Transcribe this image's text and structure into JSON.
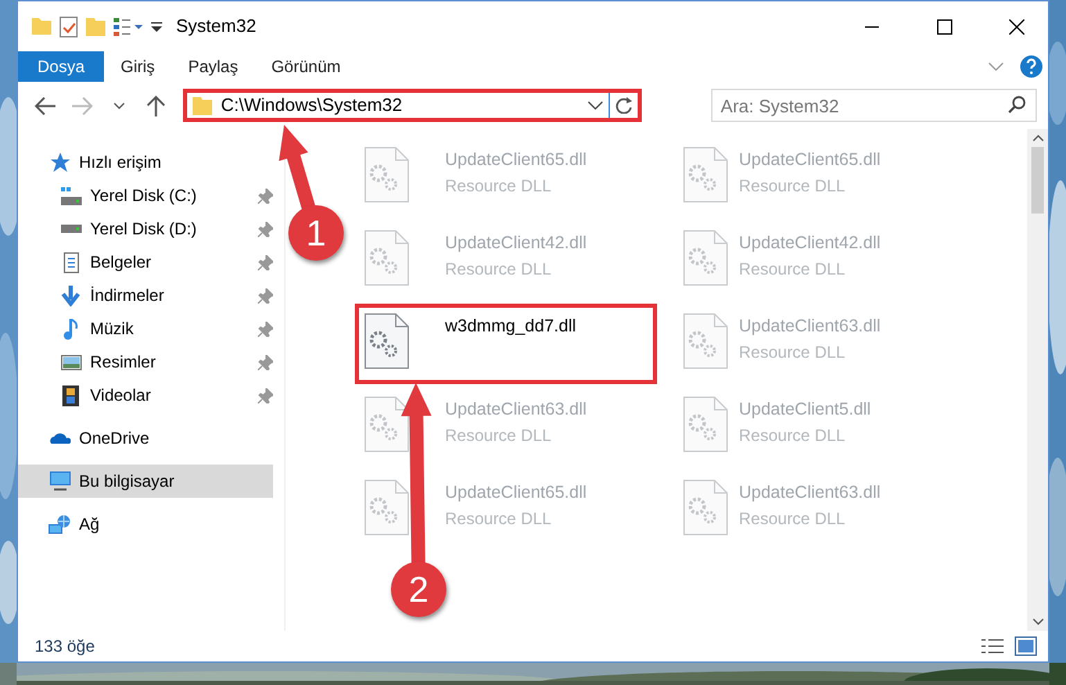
{
  "window": {
    "title": "System32"
  },
  "ribbon_tabs": [
    {
      "label": "Dosya",
      "selected": true
    },
    {
      "label": "Giriş",
      "selected": false
    },
    {
      "label": "Paylaş",
      "selected": false
    },
    {
      "label": "Görünüm",
      "selected": false
    }
  ],
  "address_bar": {
    "path": "C:\\Windows\\System32",
    "highlighted": true
  },
  "search": {
    "placeholder": "Ara: System32"
  },
  "sidebar": [
    {
      "label": "Hızlı erişim",
      "kind": "quickaccess",
      "selected": false,
      "children": [
        {
          "label": "Yerel Disk (C:)",
          "kind": "systemdrive",
          "pinned": true
        },
        {
          "label": "Yerel Disk (D:)",
          "kind": "drive",
          "pinned": true
        },
        {
          "label": "Belgeler",
          "kind": "documents",
          "pinned": true
        },
        {
          "label": "İndirmeler",
          "kind": "downloads",
          "pinned": true
        },
        {
          "label": "Müzik",
          "kind": "music",
          "pinned": true
        },
        {
          "label": "Resimler",
          "kind": "pictures",
          "pinned": true
        },
        {
          "label": "Videolar",
          "kind": "videos",
          "pinned": true
        }
      ]
    },
    {
      "label": "OneDrive",
      "kind": "cloud",
      "selected": false
    },
    {
      "label": "Bu bilgisayar",
      "kind": "computer",
      "selected": true
    },
    {
      "label": "Ağ",
      "kind": "network",
      "selected": false
    }
  ],
  "files": [
    {
      "name": "UpdateClient65.dll",
      "type": "Resource DLL",
      "blurred": true,
      "highlighted": false
    },
    {
      "name": "UpdateClient65.dll",
      "type": "Resource DLL",
      "blurred": true,
      "highlighted": false
    },
    {
      "name": "UpdateClient42.dll",
      "type": "Resource DLL",
      "blurred": true,
      "highlighted": false
    },
    {
      "name": "UpdateClient42.dll",
      "type": "Resource DLL",
      "blurred": true,
      "highlighted": false
    },
    {
      "name": "w3dmmg_dd7.dll",
      "blurred": false,
      "highlighted": true
    },
    {
      "name": "UpdateClient63.dll",
      "type": "Resource DLL",
      "blurred": true,
      "highlighted": false
    },
    {
      "name": "UpdateClient63.dll",
      "type": "Resource DLL",
      "blurred": true,
      "highlighted": false
    },
    {
      "name": "UpdateClient5.dll",
      "type": "Resource DLL",
      "blurred": true,
      "highlighted": false
    },
    {
      "name": "UpdateClient65.dll",
      "type": "Resource DLL",
      "blurred": true,
      "highlighted": false
    },
    {
      "name": "UpdateClient63.dll",
      "type": "Resource DLL",
      "blurred": true,
      "highlighted": false
    }
  ],
  "status_bar": {
    "item_count": "133 öğe"
  },
  "annotations": [
    {
      "number": "1"
    },
    {
      "number": "2"
    }
  ]
}
